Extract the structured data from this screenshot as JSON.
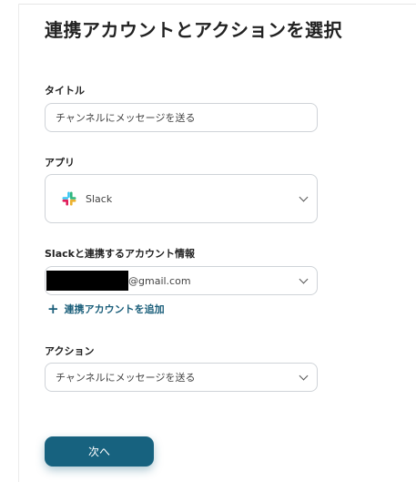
{
  "page": {
    "title": "連携アカウントとアクションを選択"
  },
  "form": {
    "title_field": {
      "label": "タイトル",
      "value": "チャンネルにメッセージを送る"
    },
    "app_field": {
      "label": "アプリ",
      "value": "Slack",
      "icon": "slack-logo-icon"
    },
    "account_field": {
      "label": "Slackと連携するアカウント情報",
      "value_visible_suffix": "@gmail.com",
      "add_account_label": "連携アカウントを追加"
    },
    "action_field": {
      "label": "アクション",
      "value": "チャンネルにメッセージを送る"
    }
  },
  "footer": {
    "next_label": "次へ"
  },
  "colors": {
    "accent": "#17627f",
    "link": "#1a5e7a",
    "border": "#cfd3d8"
  }
}
